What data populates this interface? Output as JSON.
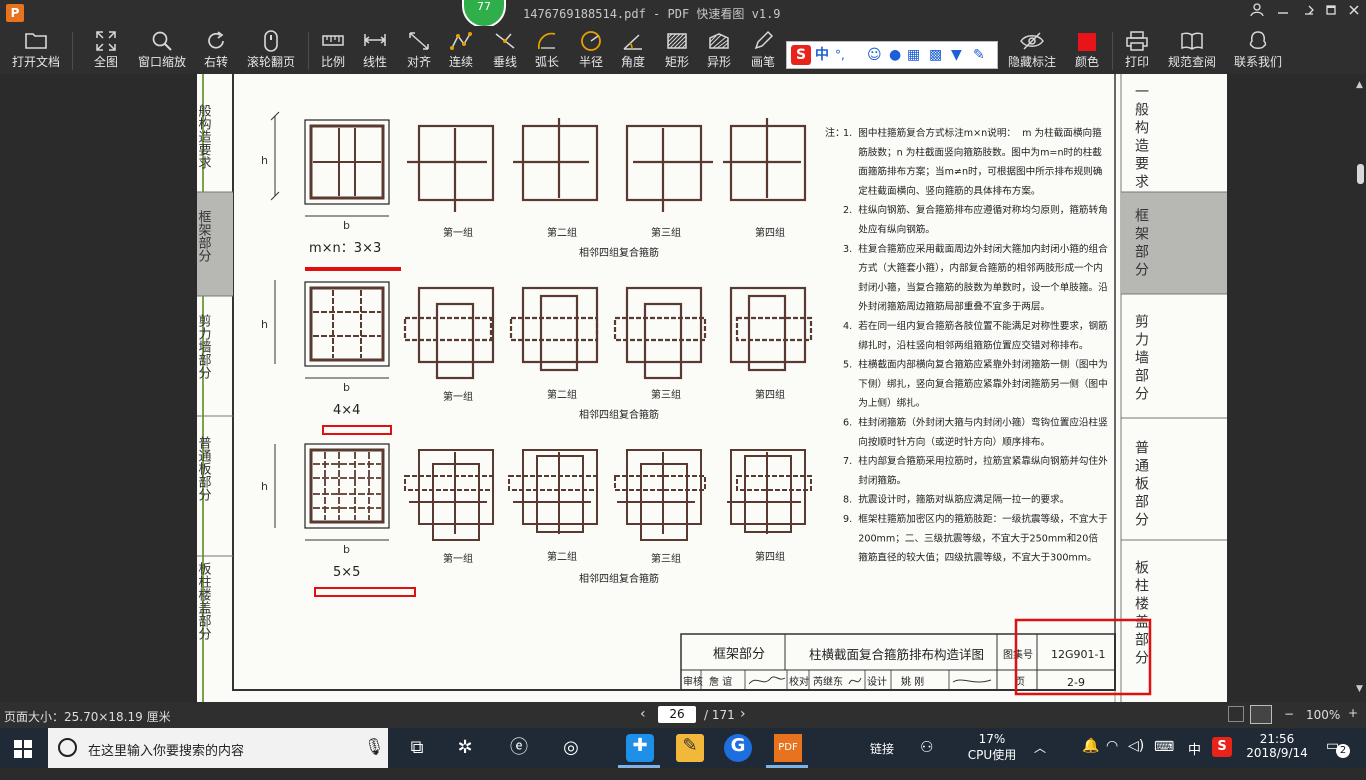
{
  "app": {
    "title": "1476769188514.pdf - PDF 快速看图 v1.9",
    "logo_letter": "P",
    "badge_count": "77",
    "user_icon": "user-icon",
    "accent_color": "#e8731e"
  },
  "toolbar": {
    "items": [
      {
        "label": "打开文档",
        "icon": "folder-icon"
      },
      {
        "label": "全图",
        "icon": "fullscreen-icon"
      },
      {
        "label": "窗口缩放",
        "icon": "search-icon"
      },
      {
        "label": "右转",
        "icon": "rotate-right-icon"
      },
      {
        "label": "滚轮翻页",
        "icon": "mouse-icon"
      },
      {
        "label": "比例",
        "icon": "ruler-icon"
      },
      {
        "label": "线性",
        "icon": "linear-measure-icon"
      },
      {
        "label": "对齐",
        "icon": "aligned-measure-icon"
      },
      {
        "label": "连续",
        "icon": "continuous-measure-icon"
      },
      {
        "label": "垂线",
        "icon": "perpendicular-icon"
      },
      {
        "label": "弧长",
        "icon": "arc-length-icon"
      },
      {
        "label": "半径",
        "icon": "radius-icon"
      },
      {
        "label": "角度",
        "icon": "angle-icon"
      },
      {
        "label": "矩形",
        "icon": "rectangle-icon"
      },
      {
        "label": "异形",
        "icon": "polygon-icon"
      },
      {
        "label": "画笔",
        "icon": "pen-icon"
      },
      {
        "label": "隐藏标注",
        "icon": "eye-hide-icon"
      },
      {
        "label": "颜色",
        "icon": "color-swatch-icon"
      },
      {
        "label": "打印",
        "icon": "printer-icon"
      },
      {
        "label": "规范查阅",
        "icon": "book-icon"
      },
      {
        "label": "联系我们",
        "icon": "contact-icon"
      }
    ],
    "color_swatch": "#e8141a"
  },
  "ime": {
    "brand": "S",
    "mode": "中",
    "punct": "°,"
  },
  "document": {
    "sections": [
      "一般构造要求",
      "框架部分",
      "剪力墙部分",
      "普通板部分",
      "板柱楼盖部分"
    ],
    "active_section": "框架部分",
    "left_sections": [
      "般构造要求",
      "框架部分",
      "剪力墙部分",
      "普通板部分",
      "板柱楼盖部分"
    ],
    "dim_h": "h",
    "dim_b": "b",
    "rows": [
      {
        "label": "m×n：3×3",
        "caption": "相邻四组复合箍筋"
      },
      {
        "label": "4×4",
        "caption": "相邻四组复合箍筋"
      },
      {
        "label": "5×5",
        "caption": "相邻四组复合箍筋"
      }
    ],
    "groups": [
      "第一组",
      "第二组",
      "第三组",
      "第四组"
    ],
    "notes_prefix": "注：",
    "notes": [
      "1.  图中柱箍筋复合方式标注m×n说明：  m 为柱截面横向箍",
      "     筋肢数；n 为柱截面竖向箍筋肢数。图中为m=n时的柱截",
      "     面箍筋排布方案；当m≠n时，可根据图中所示排布规则确",
      "     定柱截面横向、竖向箍筋的具体排布方案。",
      "2.  柱纵向钢筋、复合箍筋排布应遵循对称均匀原则，箍筋转角",
      "     处应有纵向钢筋。",
      "3.  柱复合箍筋应采用截面周边外封闭大箍加内封闭小箍的组合",
      "     方式（大箍套小箍），内部复合箍筋的相邻两肢形成一个内",
      "     封闭小箍，当复合箍筋的肢数为单数时，设一个单肢箍。沿",
      "     外封闭箍筋周边箍筋局部重叠不宜多于两层。",
      "4.  若在同一组内复合箍筋各肢位置不能满足对称性要求，钢筋",
      "     绑扎时，沿柱竖向相邻两组箍筋位置应交错对称排布。",
      "5.  柱横截面内部横向复合箍筋应紧靠外封闭箍筋一侧（图中为",
      "     下侧）绑扎，竖向复合箍筋应紧靠外封闭箍筋另一侧（图中",
      "     为上侧）绑扎。",
      "6.  柱封闭箍筋（外封闭大箍与内封闭小箍）弯钩位置应沿柱竖",
      "     向按顺时针方向（或逆时针方向）顺序排布。",
      "7.  柱内部复合箍筋采用拉筋时，拉筋宜紧靠纵向钢筋并勾住外",
      "     封闭箍筋。",
      "8.  抗震设计时，箍筋对纵筋应满足隔一拉一的要求。",
      "9.  框架柱箍筋加密区内的箍筋肢距：一级抗震等级，不宜大于",
      "     200mm；二、三级抗震等级，不宜大于250mm和20倍",
      "     箍筋直径的较大值；四级抗震等级，不宜大于300mm。"
    ],
    "titleblock": {
      "section": "框架部分",
      "title": "柱横截面复合箍筋排布构造详图",
      "atlas_label": "图集号",
      "atlas_no": "12G901-1",
      "review": "审核",
      "reviewer": "詹 谊",
      "check": "校对",
      "checker": "芮继东",
      "design": "设计",
      "designer": "姚 刚",
      "page_label": "页",
      "page_no": "2-9"
    },
    "annotation_color": "#e01010"
  },
  "statusbar": {
    "page_size": "页面大小：25.70×18.19 厘米",
    "current_page": "26",
    "total_pages": "/ 171",
    "zoom": "100%",
    "minus": "−",
    "plus": "+"
  },
  "taskbar": {
    "search_placeholder": "在这里输入你要搜索的内容",
    "link_label": "链接",
    "cpu_percent": "17%",
    "cpu_label": "CPU使用",
    "ime_mode": "中",
    "time": "21:56",
    "date": "2018/9/14",
    "notifications": "2"
  }
}
